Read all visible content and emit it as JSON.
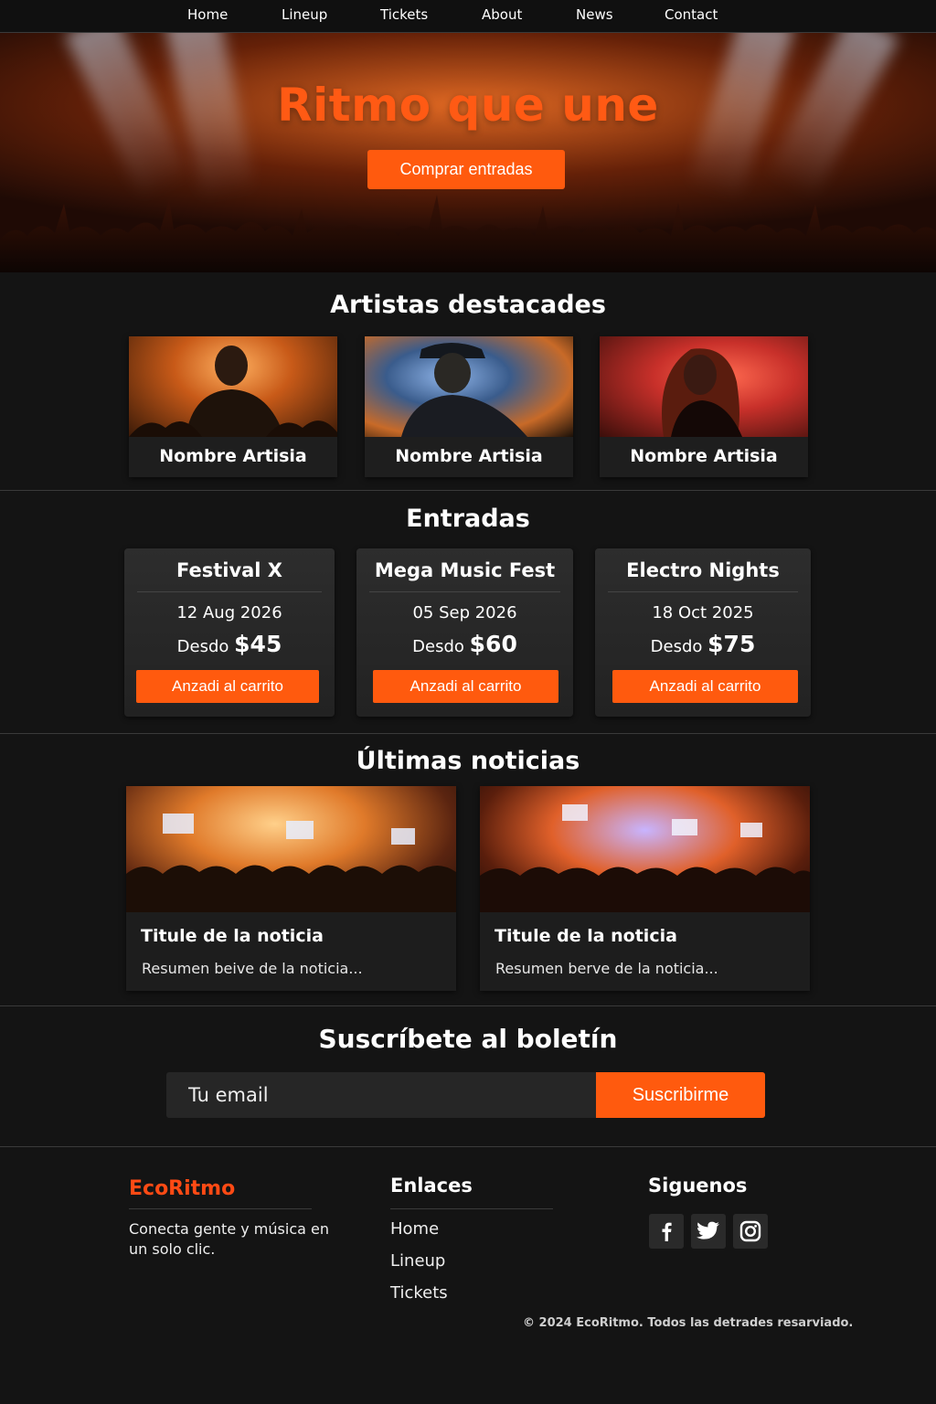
{
  "nav": {
    "items": [
      "Home",
      "Lineup",
      "Tickets",
      "About",
      "News",
      "Contact"
    ]
  },
  "hero": {
    "title": "Ritmo que une",
    "cta_label": "Comprar entradas"
  },
  "artists": {
    "heading": "Artistas destacades",
    "items": [
      {
        "name": "Nombre Artisia"
      },
      {
        "name": "Nombre Artisia"
      },
      {
        "name": "Nombre Artisia"
      }
    ]
  },
  "tickets": {
    "heading": "Entradas",
    "items": [
      {
        "event": "Festival X",
        "date": "12 Aug 2026",
        "price_prefix": "Desdo",
        "price": "$45",
        "button": "Anzadi al carrito"
      },
      {
        "event": "Mega Music Fest",
        "date": "05 Sep 2026",
        "price_prefix": "Desdo",
        "price": "$60",
        "button": "Anzadi al carrito"
      },
      {
        "event": "Electro Nights",
        "date": "18 Oct 2025",
        "price_prefix": "Desdo",
        "price": "$75",
        "button": "Anzadi al carrito"
      }
    ]
  },
  "news": {
    "heading": "Últimas noticias",
    "items": [
      {
        "title": "Titule de la noticia",
        "summary": "Resumen beive de la noticia..."
      },
      {
        "title": "Titule de la noticia",
        "summary": "Resumen berve de la noticia..."
      }
    ]
  },
  "newsletter": {
    "heading": "Suscríbete al boletín",
    "placeholder": "Tu email",
    "button": "Suscribirme"
  },
  "footer": {
    "brand": "EcoRitmo",
    "tagline": "Conecta gente y música en un solo clic.",
    "links_heading": "Enlaces",
    "links": [
      "Home",
      "Lineup",
      "Tickets"
    ],
    "social_heading": "Siguenos",
    "social_icons": [
      "facebook-icon",
      "twitter-icon",
      "instagram-icon"
    ],
    "copyright": "© 2024 EcoRitmo. Todos las detrades resarviado."
  },
  "colors": {
    "accent": "#ff5a0e",
    "brand": "#ff4a14",
    "background": "#141414"
  }
}
